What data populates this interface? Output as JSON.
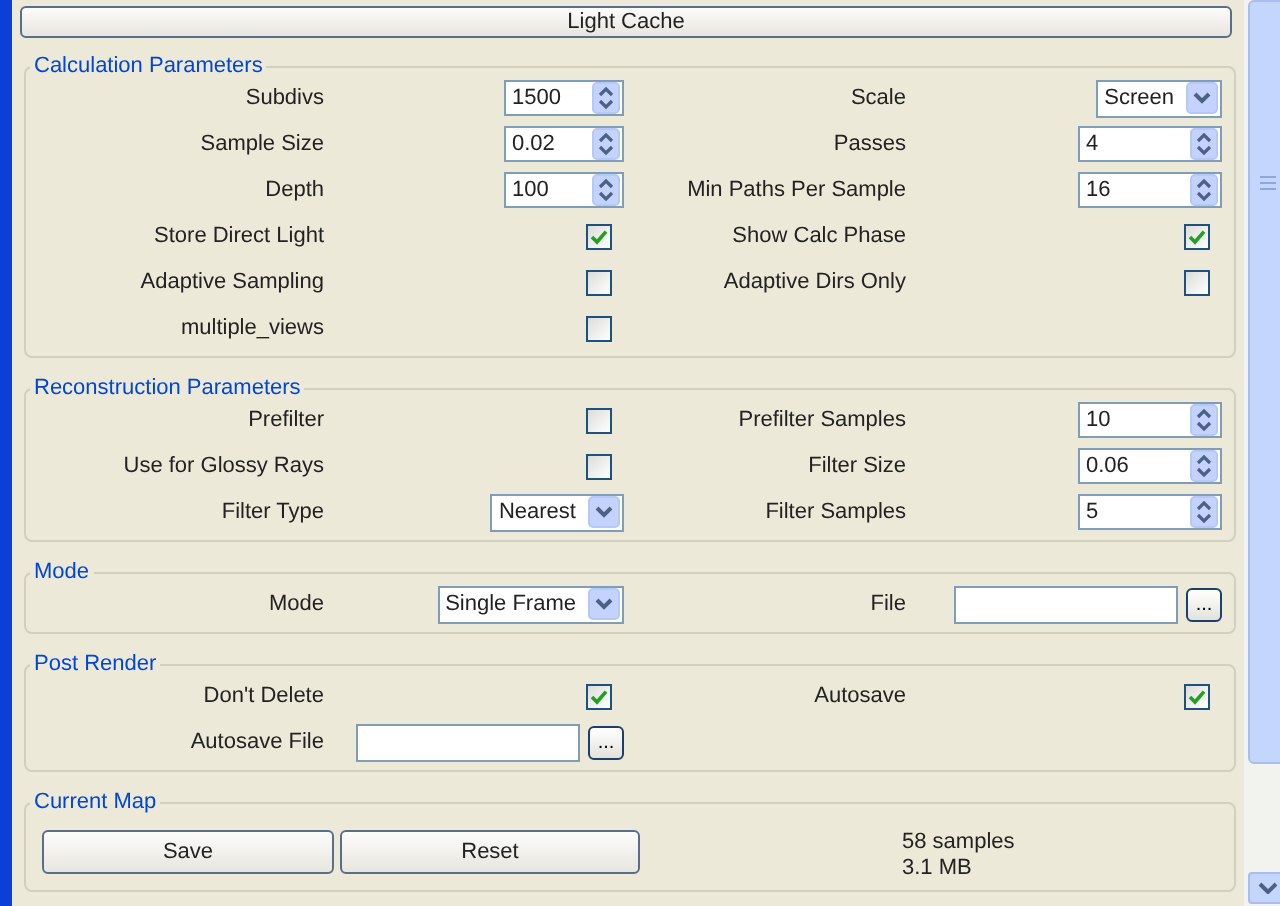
{
  "header": {
    "label": "Light Cache"
  },
  "groups": [
    {
      "title": "Calculation Parameters",
      "kind": "form",
      "rows": [
        {
          "left": {
            "label": "Subdivs",
            "kind": "spinner",
            "value": "1500"
          },
          "right": {
            "label": "Scale",
            "kind": "dropdown",
            "value": "Screen"
          }
        },
        {
          "left": {
            "label": "Sample Size",
            "kind": "spinner",
            "value": "0.02"
          },
          "right": {
            "label": "Passes",
            "kind": "spinner",
            "value": "4"
          }
        },
        {
          "left": {
            "label": "Depth",
            "kind": "spinner",
            "value": "100"
          },
          "right": {
            "label": "Min Paths Per Sample",
            "kind": "spinner",
            "value": "16"
          }
        },
        {
          "left": {
            "label": "Store Direct Light",
            "kind": "checkbox",
            "checked": true
          },
          "right": {
            "label": "Show Calc Phase",
            "kind": "checkbox",
            "checked": true
          }
        },
        {
          "left": {
            "label": "Adaptive Sampling",
            "kind": "checkbox",
            "checked": false
          },
          "right": {
            "label": "Adaptive Dirs Only",
            "kind": "checkbox",
            "checked": false
          }
        },
        {
          "left": {
            "label": "multiple_views",
            "kind": "checkbox",
            "checked": false
          }
        }
      ]
    },
    {
      "title": "Reconstruction Parameters",
      "kind": "form",
      "rows": [
        {
          "left": {
            "label": "Prefilter",
            "kind": "checkbox",
            "checked": false
          },
          "right": {
            "label": "Prefilter Samples",
            "kind": "spinner",
            "value": "10"
          }
        },
        {
          "left": {
            "label": "Use for Glossy Rays",
            "kind": "checkbox",
            "checked": false
          },
          "right": {
            "label": "Filter Size",
            "kind": "spinner",
            "value": "0.06"
          }
        },
        {
          "left": {
            "label": "Filter Type",
            "kind": "dropdown",
            "value": "Nearest"
          },
          "right": {
            "label": "Filter Samples",
            "kind": "spinner",
            "value": "5"
          }
        }
      ]
    },
    {
      "title": "Mode",
      "kind": "form",
      "rows": [
        {
          "left": {
            "label": "Mode",
            "kind": "dropdown",
            "value": "Single Frame"
          },
          "right": {
            "label": "File",
            "kind": "file",
            "browse": "..."
          }
        }
      ]
    },
    {
      "title": "Post Render",
      "kind": "form",
      "rows": [
        {
          "left": {
            "label": "Don't Delete",
            "kind": "checkbox",
            "checked": true
          },
          "right": {
            "label": "Autosave",
            "kind": "checkbox",
            "checked": true
          }
        },
        {
          "left": {
            "label": "Autosave File",
            "kind": "file",
            "browse": "..."
          }
        }
      ]
    },
    {
      "title": "Current Map",
      "kind": "map",
      "buttons": [
        "Save",
        "Reset"
      ],
      "info": [
        "58 samples",
        "3.1 MB"
      ]
    }
  ]
}
